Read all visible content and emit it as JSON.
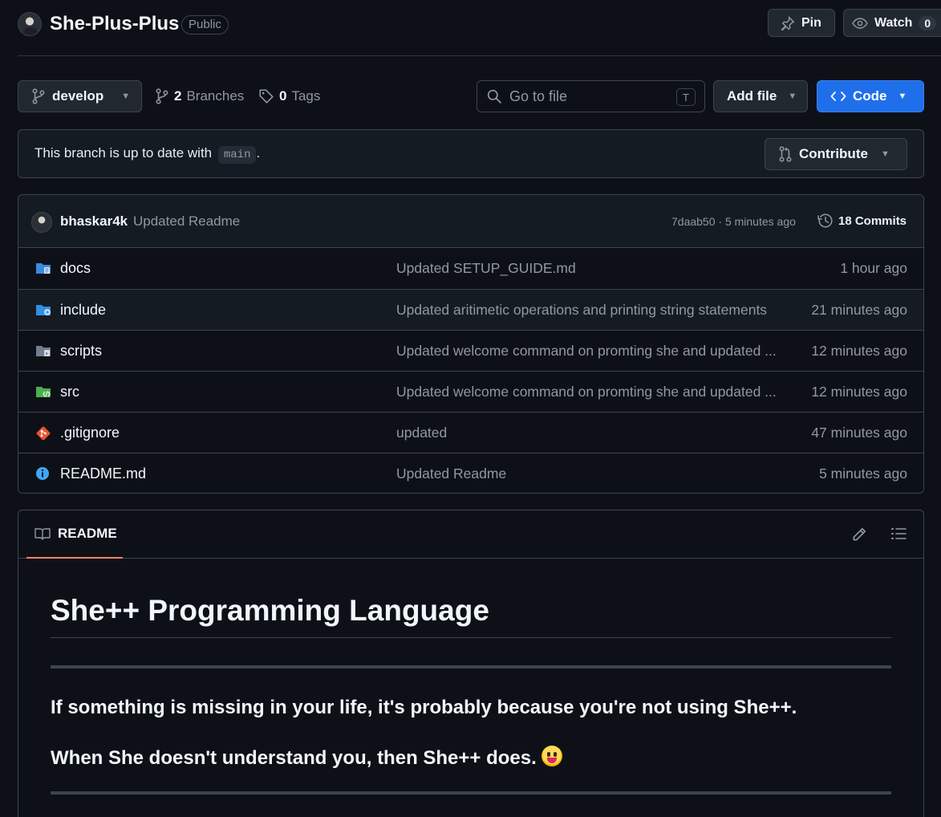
{
  "repo": {
    "name": "She-Plus-Plus",
    "visibility": "Public",
    "pin_label": "Pin",
    "watch_label": "Watch",
    "watch_count": "0"
  },
  "toolbar": {
    "branch": "develop",
    "branches_count": "2",
    "branches_label": "Branches",
    "tags_count": "0",
    "tags_label": "Tags",
    "search_placeholder": "Go to file",
    "search_shortcut": "T",
    "add_file_label": "Add file",
    "code_label": "Code"
  },
  "banner": {
    "text": "This branch is up to date with",
    "branch": "main",
    "suffix": ".",
    "contribute_label": "Contribute"
  },
  "latest_commit": {
    "author": "bhaskar4k",
    "message": "Updated Readme",
    "meta": "7daab50 · 5 minutes ago",
    "commits_label": "18 Commits"
  },
  "files": [
    {
      "name": "docs",
      "icon": "docs-folder-icon",
      "commit": "Updated SETUP_GUIDE.md",
      "time": "1 hour ago"
    },
    {
      "name": "include",
      "icon": "include-folder-icon",
      "commit": "Updated aritimetic operations and printing string statements",
      "time": "21 minutes ago"
    },
    {
      "name": "scripts",
      "icon": "scripts-folder-icon",
      "commit": "Updated welcome command on promting she and updated ...",
      "time": "12 minutes ago"
    },
    {
      "name": "src",
      "icon": "src-folder-icon",
      "commit": "Updated welcome command on promting she and updated ...",
      "time": "12 minutes ago"
    },
    {
      "name": ".gitignore",
      "icon": "git-icon",
      "commit": "updated",
      "time": "47 minutes ago"
    },
    {
      "name": "README.md",
      "icon": "info-icon",
      "commit": "Updated Readme",
      "time": "5 minutes ago"
    }
  ],
  "readme": {
    "tab_label": "README",
    "title": "She++ Programming Language",
    "line1": "If something is missing in your life, it's probably because you're not using She++.",
    "line2": "When She doesn't understand you, then She++ does."
  },
  "colors": {
    "background": "#0d1117",
    "border": "#3d444d",
    "accent_blue": "#1f6feb",
    "muted_text": "#9198a1",
    "tab_underline": "#f78166"
  }
}
